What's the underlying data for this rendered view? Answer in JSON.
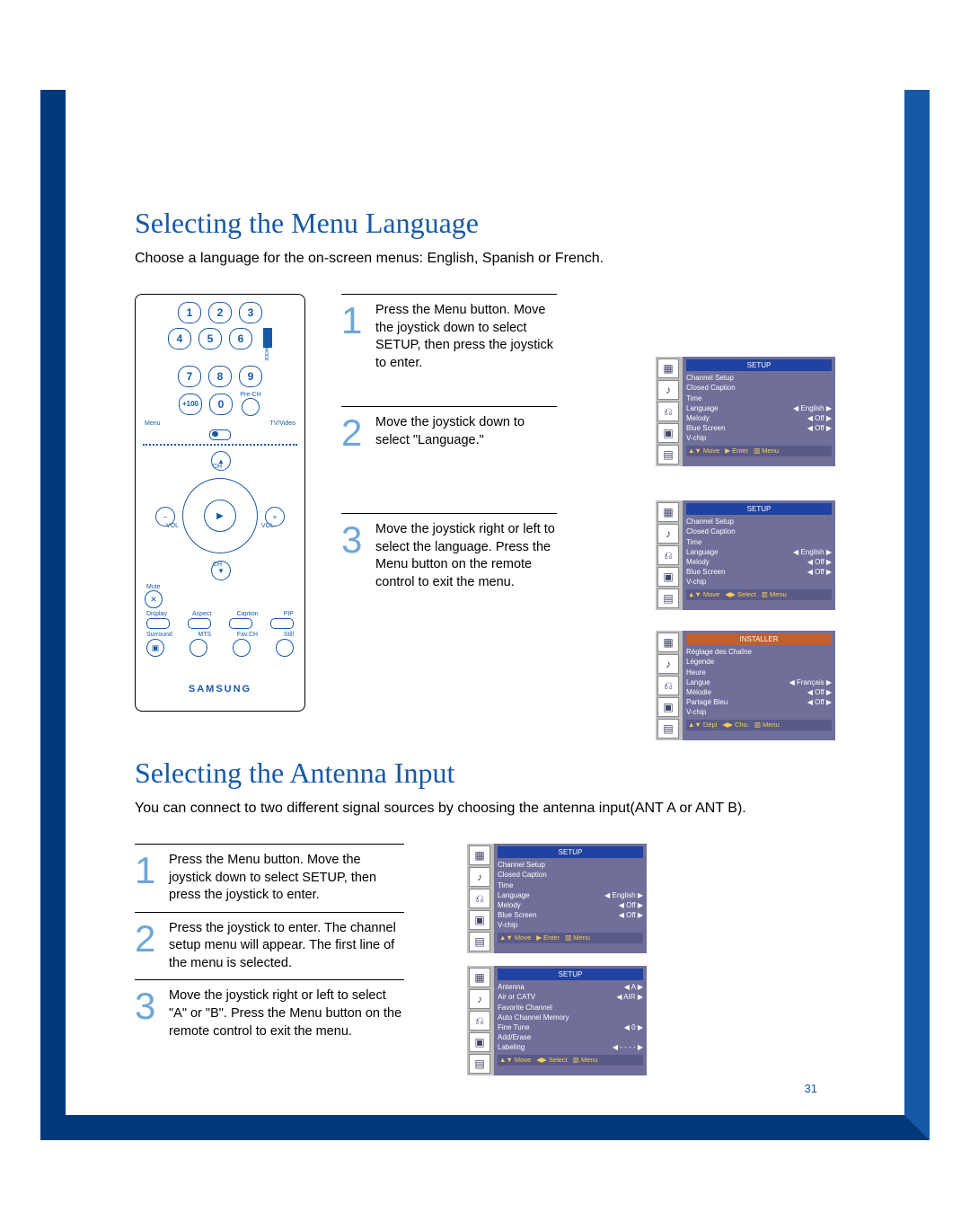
{
  "page_number": "31",
  "remote": {
    "nums": [
      "1",
      "2",
      "3",
      "4",
      "5",
      "6",
      "7",
      "8",
      "9",
      "+100",
      "0"
    ],
    "prech": "Pre-CH",
    "menu": "Menu",
    "tvvideo": "TV/Video",
    "mode": "MODE",
    "joy": {
      "up": "▲",
      "down": "CH",
      "left": "VOL",
      "right": "VOL",
      "center": "▶"
    },
    "ch_up": "CH",
    "vol_minus": "–",
    "vol_plus": "+",
    "mute": "Mute",
    "row1": [
      "Display",
      "Aspect",
      "Caption",
      "PIP"
    ],
    "row2": [
      "Surround",
      "MTS",
      "Fav.CH",
      "Still"
    ],
    "still_icon": "▣",
    "brand": "SAMSUNG"
  },
  "section1": {
    "title": "Selecting the Menu Language",
    "intro": "Choose a language for the on-screen menus: English, Spanish or French.",
    "steps": [
      {
        "n": "1",
        "t": "Press the Menu button.\nMove the joystick down to select SETUP, then press the joystick to enter."
      },
      {
        "n": "2",
        "t": "Move the joystick down to select \"Language.\""
      },
      {
        "n": "3",
        "t": "Move the joystick right or left to select the language.\nPress the Menu button on the remote control to exit the menu."
      }
    ],
    "osd1": {
      "title": "SETUP",
      "lines": [
        {
          "l": "Channel Setup",
          "v": ""
        },
        {
          "l": "Closed Caption",
          "v": ""
        },
        {
          "l": "Time",
          "v": ""
        },
        {
          "l": "Language",
          "v": "◀ English ▶"
        },
        {
          "l": "Melody",
          "v": "◀   Off   ▶"
        },
        {
          "l": "Blue Screen",
          "v": "◀   Off   ▶"
        },
        {
          "l": "V-chip",
          "v": ""
        }
      ],
      "foot": [
        "▲▼ Move",
        "▶ Enter",
        "▥ Menu"
      ]
    },
    "osd2": {
      "title": "SETUP",
      "lines": [
        {
          "l": "Channel Setup",
          "v": ""
        },
        {
          "l": "Closed Caption",
          "v": ""
        },
        {
          "l": "Time",
          "v": ""
        },
        {
          "l": "Language",
          "v": "◀ English ▶"
        },
        {
          "l": "Melody",
          "v": "◀   Off   ▶"
        },
        {
          "l": "Blue Screen",
          "v": "◀   Off   ▶"
        },
        {
          "l": "V-chip",
          "v": ""
        }
      ],
      "foot": [
        "▲▼ Move",
        "◀▶ Select",
        "▥ Menu"
      ]
    },
    "osd3": {
      "title": "INSTALLER",
      "lines": [
        {
          "l": "Réglage des Chaîne",
          "v": ""
        },
        {
          "l": "Légende",
          "v": ""
        },
        {
          "l": "Heure",
          "v": ""
        },
        {
          "l": "Langue",
          "v": "◀ Français ▶"
        },
        {
          "l": "Mélodie",
          "v": "◀   Off   ▶"
        },
        {
          "l": "Partagé Bleu",
          "v": "◀   Off   ▶"
        },
        {
          "l": "V-chip",
          "v": ""
        }
      ],
      "foot": [
        "▲▼ Dépl",
        "◀▶ Cho.",
        "▥ Menu"
      ]
    }
  },
  "section2": {
    "title": "Selecting the Antenna Input",
    "intro": "You can connect to two different signal sources by choosing the antenna input(ANT A or ANT B).",
    "steps": [
      {
        "n": "1",
        "t": "Press the Menu button.\nMove the joystick down to select SETUP, then press the joystick to enter."
      },
      {
        "n": "2",
        "t": "Press the joystick to enter. The channel setup menu will appear. The first line of the menu is selected."
      },
      {
        "n": "3",
        "t": "Move the joystick right or left to select \"A\" or \"B\".\nPress the Menu button on the remote control to exit the menu."
      }
    ],
    "osd4": {
      "title": "SETUP",
      "lines": [
        {
          "l": "Channel Setup",
          "v": ""
        },
        {
          "l": "Closed Caption",
          "v": ""
        },
        {
          "l": "Time",
          "v": ""
        },
        {
          "l": "Language",
          "v": "◀ English ▶"
        },
        {
          "l": "Melody",
          "v": "◀   Off   ▶"
        },
        {
          "l": "Blue Screen",
          "v": "◀   Off   ▶"
        },
        {
          "l": "V-chip",
          "v": ""
        }
      ],
      "foot": [
        "▲▼ Move",
        "▶ Enter",
        "▥ Menu"
      ]
    },
    "osd5": {
      "title": "SETUP",
      "lines": [
        {
          "l": "Antenna",
          "v": "◀     A     ▶"
        },
        {
          "l": "Air or CATV",
          "v": "◀   AIR   ▶"
        },
        {
          "l": "Favorite Channel",
          "v": ""
        },
        {
          "l": "Auto Channel Memory",
          "v": ""
        },
        {
          "l": "Fine Tune",
          "v": "◀     0     ▶"
        },
        {
          "l": "Add/Erase",
          "v": ""
        },
        {
          "l": "Labeling",
          "v": "◀   - - - -   ▶"
        }
      ],
      "foot": [
        "▲▼ Move",
        "◀▶ Select",
        "▥ Menu"
      ]
    }
  }
}
